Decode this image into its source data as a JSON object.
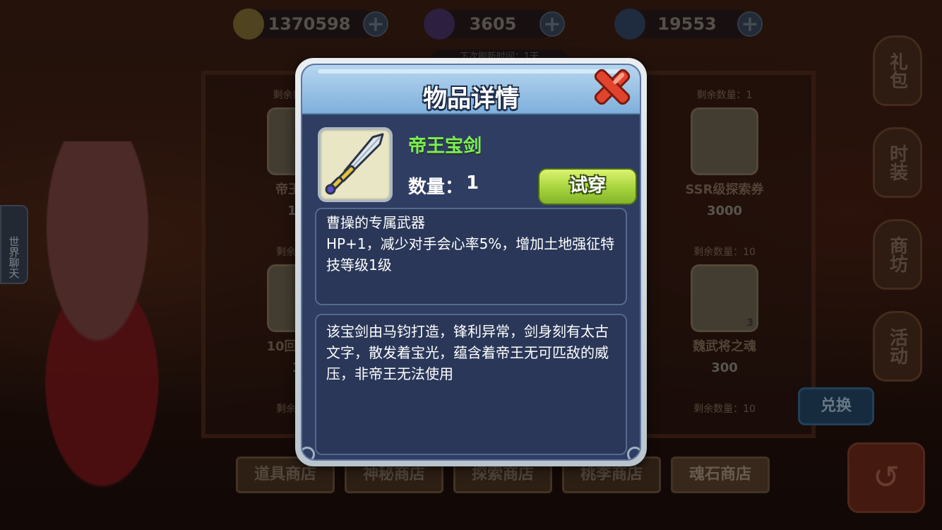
{
  "resources": {
    "copper": "1370598",
    "diamond": "3605",
    "crystal": "19553",
    "plus": "+"
  },
  "background": {
    "shelf_items": [
      {
        "remaining": "剩余数量：1",
        "name": "帝王宝剑",
        "price": "120"
      },
      {
        "remaining": "剩余数量：1",
        "name": "SSR级探索券",
        "price": "3000"
      },
      {
        "remaining": "剩余数量：",
        "name": "10回探索券",
        "price": "15"
      },
      {
        "remaining": "剩余数量：10",
        "name": "魏武将之魂",
        "price": "300"
      },
      {
        "remaining": "剩余数量：",
        "name": "",
        "price": ""
      },
      {
        "remaining": "剩余数量：10",
        "name": "",
        "price": ""
      }
    ],
    "tabs": [
      "道具商店",
      "神秘商店",
      "探索商店",
      "桃李商店",
      "魂石商店"
    ],
    "side_buttons": [
      "礼包",
      "时装",
      "商坊",
      "活动"
    ],
    "exchange": "兑换",
    "world_chat": "世界聊天",
    "badge_count": "3",
    "refresh_hint": "下次刷新时间：1天"
  },
  "dialog": {
    "title": "物品详情",
    "item_name": "帝王宝剑",
    "qty_label": "数量：",
    "qty_value": "1",
    "try_button": "试穿",
    "owner_line": "曹操的专属武器",
    "effect_text": "HP+1，减少对手会心率5%，增加土地强征特技等级1级",
    "lore_text": "该宝剑由马钧打造，锋利异常，剑身刻有太古文字，散发着宝光，蕴含着帝王无可匹敌的威压，非帝王无法使用"
  },
  "colors": {
    "dialog_panel": "#2f3d62",
    "item_name_green": "#7cee54",
    "try_button_green": "#a5d33c",
    "close_red": "#e2432c"
  }
}
